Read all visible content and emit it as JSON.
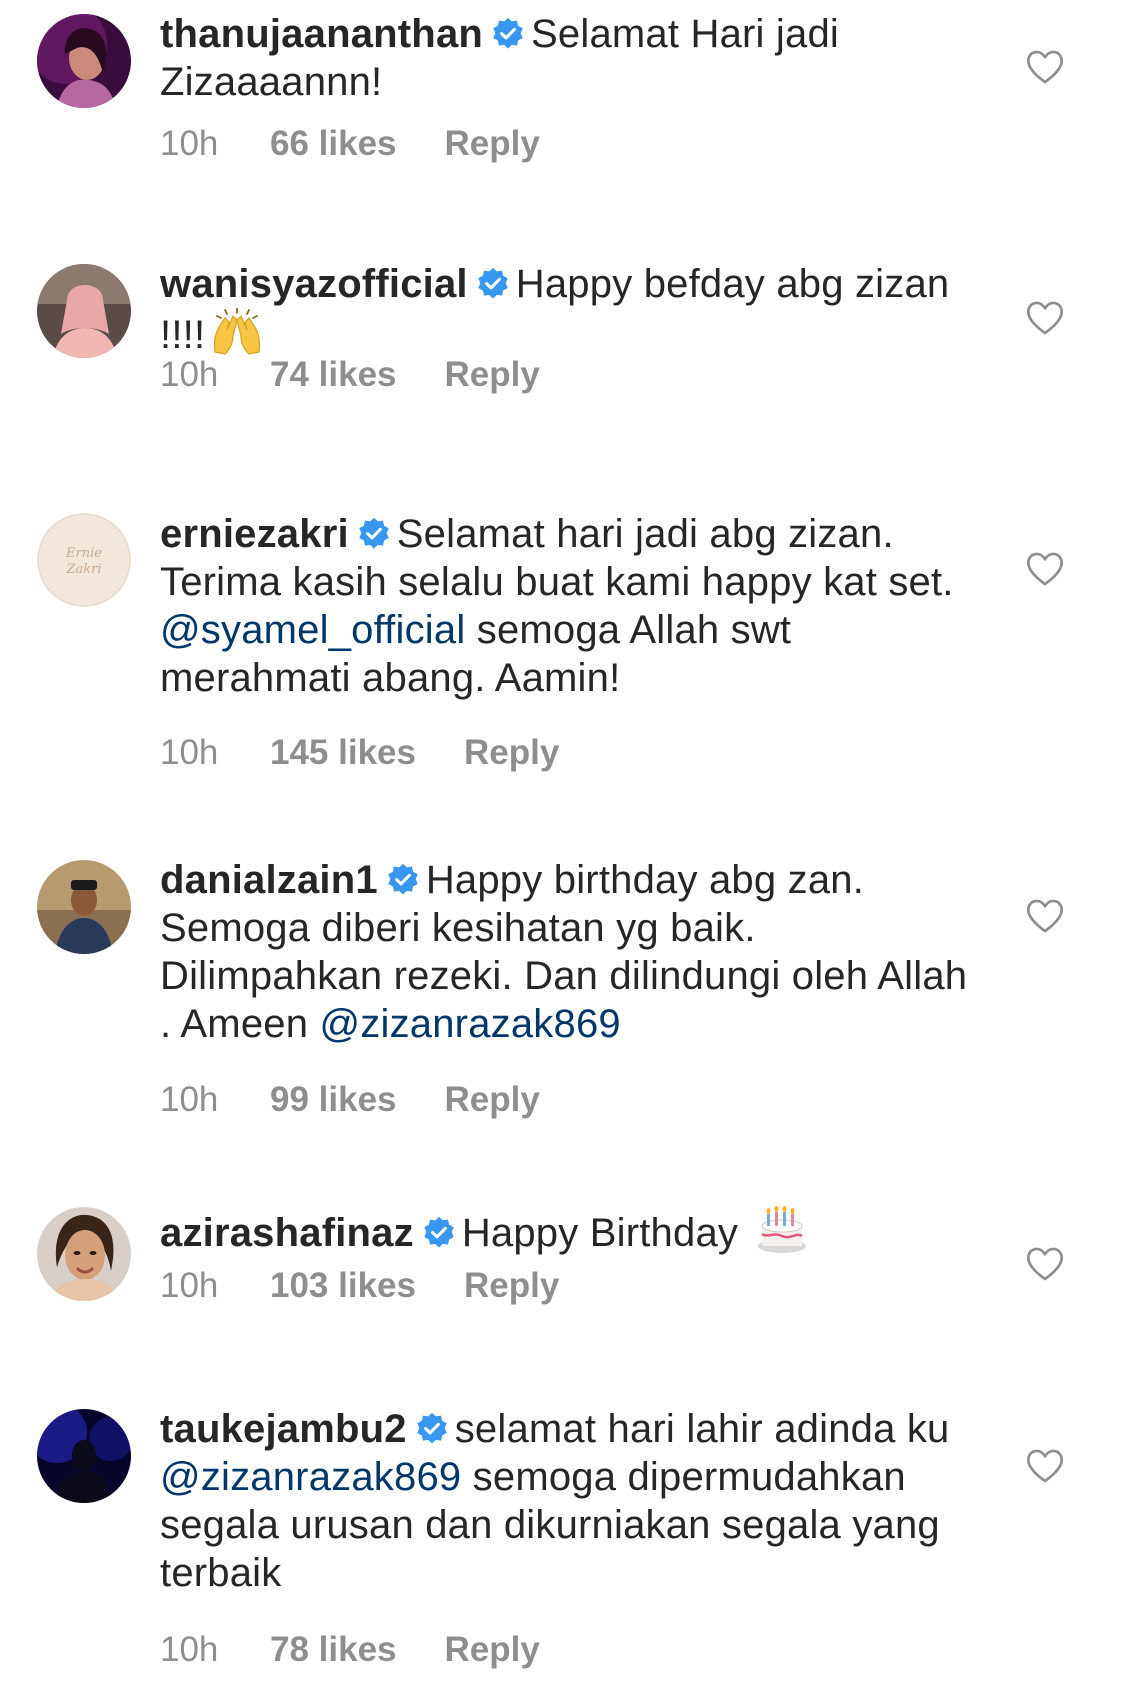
{
  "comments": [
    {
      "username": "thanujaananthan",
      "verified": true,
      "text": "Selamat Hari jadi Zizaaaannn!",
      "time": "10h",
      "likes": "66 likes",
      "reply": "Reply",
      "avatar": "avatar-photo"
    },
    {
      "username": "wanisyazofficial",
      "verified": true,
      "text": "Happy befday abg zizan !!!!",
      "emoji": "raising-hands-icon",
      "time": "10h",
      "likes": "74 likes",
      "reply": "Reply",
      "avatar": "avatar-photo"
    },
    {
      "username": "erniezakri",
      "verified": true,
      "text_before": "Selamat hari jadi abg zizan. Terima kasih selalu buat kami happy kat set.",
      "mention": "@syamel_official",
      "text_after": "semoga Allah swt merahmati abang. Aamin!",
      "time": "10h",
      "likes": "145 likes",
      "reply": "Reply",
      "avatar": "avatar-logo"
    },
    {
      "username": "danialzain1",
      "verified": true,
      "text_before": "Happy birthday abg zan. Semoga diberi kesihatan yg baik. Dilimpahkan rezeki. Dan dilindungi oleh Allah . Ameen",
      "mention": "@zizanrazak869",
      "time": "10h",
      "likes": "99 likes",
      "reply": "Reply",
      "avatar": "avatar-photo"
    },
    {
      "username": "azirashafinaz",
      "verified": true,
      "text": "Happy Birthday",
      "emoji": "birthday-cake-icon",
      "time": "10h",
      "likes": "103 likes",
      "reply": "Reply",
      "avatar": "avatar-photo"
    },
    {
      "username": "taukejambu2",
      "verified": true,
      "text_before": "selamat hari lahir adinda ku",
      "mention": "@zizanrazak869",
      "text_after": "semoga dipermudahkan segala urusan dan dikurniakan segala yang terbaik",
      "time": "10h",
      "likes": "78 likes",
      "reply": "Reply",
      "avatar": "avatar-photo"
    }
  ],
  "colors": {
    "text": "#262626",
    "secondary": "#8e8e8e",
    "mention": "#00376b",
    "verified": "#3897f0"
  }
}
